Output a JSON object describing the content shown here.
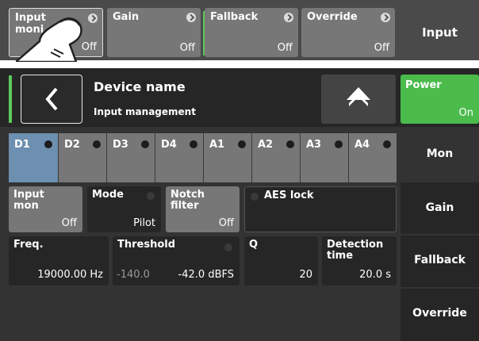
{
  "top_tiles": [
    {
      "label": "Input\nmoni",
      "value": "Off"
    },
    {
      "label": "Gain",
      "value": "Off"
    },
    {
      "label": "Fallback",
      "value": "Off"
    },
    {
      "label": "Override",
      "value": "Off"
    }
  ],
  "top_input_label": "Input",
  "header": {
    "title": "Device name",
    "subtitle": "Input management",
    "power_label": "Power",
    "power_value": "On"
  },
  "channels": [
    "D1",
    "D2",
    "D3",
    "D4",
    "A1",
    "A2",
    "A3",
    "A4"
  ],
  "side_tabs": [
    "Mon",
    "Gain",
    "Fallback",
    "Override"
  ],
  "controls": {
    "input_mon": {
      "label": "Input\nmon",
      "value": "Off"
    },
    "mode": {
      "label": "Mode",
      "value": "Pilot"
    },
    "notch": {
      "label": "Notch\nfilter",
      "value": "Off"
    },
    "aes_lock": {
      "label": "AES lock"
    }
  },
  "params": {
    "freq": {
      "label": "Freq.",
      "value": "19000.00 Hz"
    },
    "threshold": {
      "label": "Threshold",
      "min": "-140.0",
      "value": "-42.0 dBFS"
    },
    "q": {
      "label": "Q",
      "value": "20"
    },
    "detection": {
      "label": "Detection\ntime",
      "value": "20.0 s"
    }
  },
  "colors": {
    "accent_green": "#4bbb4b",
    "selected_channel": "#6d8fb0"
  },
  "icons": [
    "chevron-left-icon",
    "home-icon",
    "arrow-right-icon",
    "finger-pointer-icon"
  ]
}
